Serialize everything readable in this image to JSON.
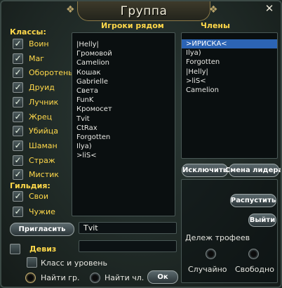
{
  "window": {
    "title": "Группа"
  },
  "filters": {
    "classes_label": "Классы:",
    "classes": [
      {
        "label": "Воин",
        "checked": true
      },
      {
        "label": "Маг",
        "checked": true
      },
      {
        "label": "Оборотень",
        "checked": true
      },
      {
        "label": "Друид",
        "checked": true
      },
      {
        "label": "Лучник",
        "checked": true
      },
      {
        "label": "Жрец",
        "checked": true
      },
      {
        "label": "Убийца",
        "checked": true
      },
      {
        "label": "Шаман",
        "checked": true
      },
      {
        "label": "Страж",
        "checked": true
      },
      {
        "label": "Мистик",
        "checked": true
      }
    ],
    "guild_label": "Гильдия:",
    "guild": [
      {
        "label": "Свои",
        "checked": true
      },
      {
        "label": "Чужие",
        "checked": true
      }
    ]
  },
  "nearby": {
    "heading": "Игроки рядом",
    "players": [
      "|Helly|",
      "Громовой",
      "Camelion",
      "Кошак",
      "Gabrielle",
      "Света",
      "FunK",
      "Кромосет",
      "Tvit",
      "CtRax",
      "Forgotten",
      "Ilya)",
      ">liS<"
    ]
  },
  "members": {
    "heading": "Члены",
    "list": [
      ">ИРИСКА<",
      "Ilya)",
      "Forgotten",
      "|Helly|",
      ">liS<",
      "Camelion"
    ],
    "selected_index": 0
  },
  "buttons": {
    "kick": "Исключить",
    "change_leader": "Смена лидера",
    "disband": "Распустить",
    "leave": "Выйти",
    "invite": "Пригласить",
    "ok": "Ок"
  },
  "invite_input": {
    "value": "Tvit"
  },
  "motto": {
    "label": "Девиз",
    "checked": false,
    "value": ""
  },
  "loot": {
    "heading": "Дележ трофеев",
    "options": [
      "Случайно",
      "Свободно"
    ]
  },
  "options": {
    "class_level": {
      "label": "Класс и уровень",
      "checked": false
    },
    "find_group": "Найти гр.",
    "find_member": "Найти чл."
  }
}
